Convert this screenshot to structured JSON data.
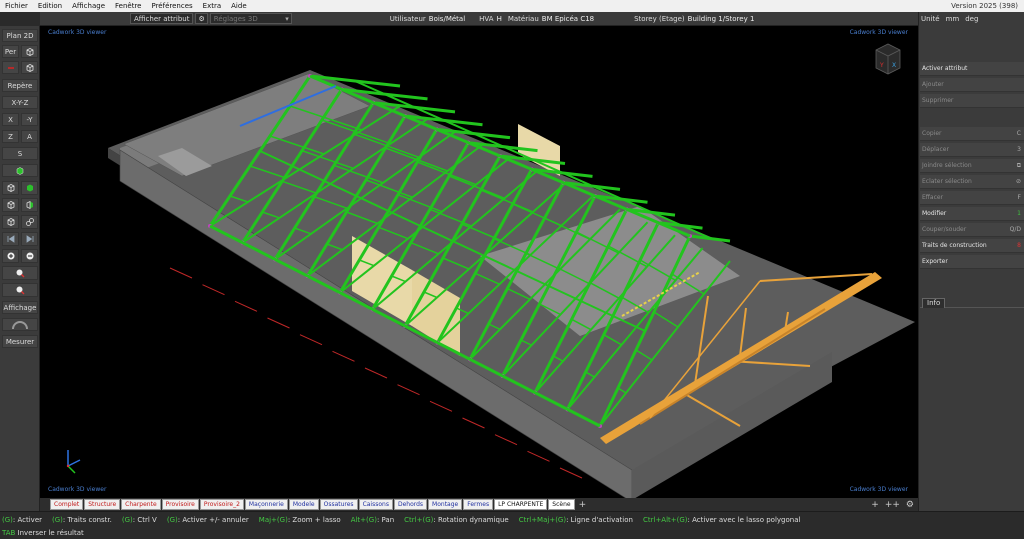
{
  "menu": {
    "items": [
      "Fichier",
      "Edition",
      "Affichage",
      "Fenêtre",
      "Préférences",
      "Extra",
      "Aide"
    ],
    "version": "Version 2025 (398)"
  },
  "toolbar": {
    "afficher_attribut": "Afficher attribut",
    "reglages_placeholder": "Réglages 3D",
    "utilisateur_label": "Utilisateur",
    "utilisateur_value": "Bois/Métal",
    "hva_label": "HVA",
    "hva_value": "H",
    "materiau_label": "Matériau",
    "materiau_value": "BM Epicéa C18",
    "storey_label": "Storey (Etage)",
    "storey_value": "Building 1/Storey 1"
  },
  "left_toolbar": {
    "plan2d": "Plan 2D",
    "per": "Per",
    "repere": "Repère",
    "xyz": "X-Y-Z",
    "x": "X",
    "minus_y": "-Y",
    "z": "Z",
    "a": "A",
    "s": "S",
    "affichage": "Affichage",
    "mesurer": "Mesurer"
  },
  "viewport": {
    "label": "Cadwork 3D viewer",
    "navcube_letters": [
      "Y",
      "X"
    ]
  },
  "tabs": [
    {
      "label": "Complet",
      "color": "red"
    },
    {
      "label": "Structure",
      "color": "red"
    },
    {
      "label": "Charpente",
      "color": "red"
    },
    {
      "label": "Provisoire",
      "color": "red"
    },
    {
      "label": "Provisoire_2",
      "color": "red"
    },
    {
      "label": "Maçonnerie",
      "color": "blue"
    },
    {
      "label": "Modele",
      "color": "blue"
    },
    {
      "label": "Ossatures",
      "color": "blue"
    },
    {
      "label": "Caissons",
      "color": "blue"
    },
    {
      "label": "Dehords",
      "color": "blue"
    },
    {
      "label": "Montage",
      "color": "blue"
    },
    {
      "label": "Fermes",
      "color": "blue"
    },
    {
      "label": "LP CHARPENTE",
      "color": "dark"
    },
    {
      "label": "Scène",
      "color": "dark"
    }
  ],
  "tabs_right": [
    "+",
    "++",
    "⚙"
  ],
  "right_panel": {
    "units_label": "Unité",
    "units": [
      "mm",
      "deg"
    ],
    "items": [
      {
        "label": "Activer attribut",
        "shortcut": "",
        "enabled": true
      },
      {
        "label": "Ajouter",
        "shortcut": "",
        "enabled": false
      },
      {
        "label": "Supprimer",
        "shortcut": "",
        "enabled": false
      },
      {
        "label": "Copier",
        "shortcut": "C",
        "enabled": false
      },
      {
        "label": "Déplacer",
        "shortcut": "3",
        "enabled": false
      },
      {
        "label": "Joindre sélection",
        "shortcut": "",
        "enabled": false
      },
      {
        "label": "Eclater sélection",
        "shortcut": "",
        "enabled": false
      },
      {
        "label": "Effacer",
        "shortcut": "F",
        "enabled": false
      },
      {
        "label": "Modifier",
        "shortcut": "1",
        "enabled": true,
        "shortcut_color": "green"
      },
      {
        "label": "Couper/souder",
        "shortcut": "Q/D",
        "enabled": false
      },
      {
        "label": "Traits de construction",
        "shortcut": "8",
        "enabled": true,
        "shortcut_color": "red"
      },
      {
        "label": "Exporter",
        "shortcut": "",
        "enabled": true
      }
    ],
    "info_tab": "Info"
  },
  "status": {
    "row1": [
      {
        "key": "(G)",
        "text": ": Activer"
      },
      {
        "key": "(G)",
        "text": ": Traits constr."
      },
      {
        "key": "(G)",
        "text": ": Ctrl V"
      },
      {
        "key": "(G)",
        "text": ": Activer +/- annuler"
      },
      {
        "key": "Maj+(G)",
        "text": ": Zoom + lasso"
      },
      {
        "key": "Alt+(G)",
        "text": ": Pan"
      },
      {
        "key": "Ctrl+(G)",
        "text": ": Rotation dynamique"
      },
      {
        "key": "Ctrl+Maj+(G)",
        "text": ": Ligne d'activation"
      },
      {
        "key": "Ctrl+Alt+(G)",
        "text": ": Activer avec le lasso polygonal"
      }
    ],
    "row2": [
      {
        "key": "TAB",
        "text": " Inverser le résultat"
      }
    ]
  },
  "colors": {
    "truss_green": "#22c41e",
    "timber": "#e8a23a",
    "wall_gray": "#6f6f6f",
    "accent_blue": "#4a7fd0"
  }
}
